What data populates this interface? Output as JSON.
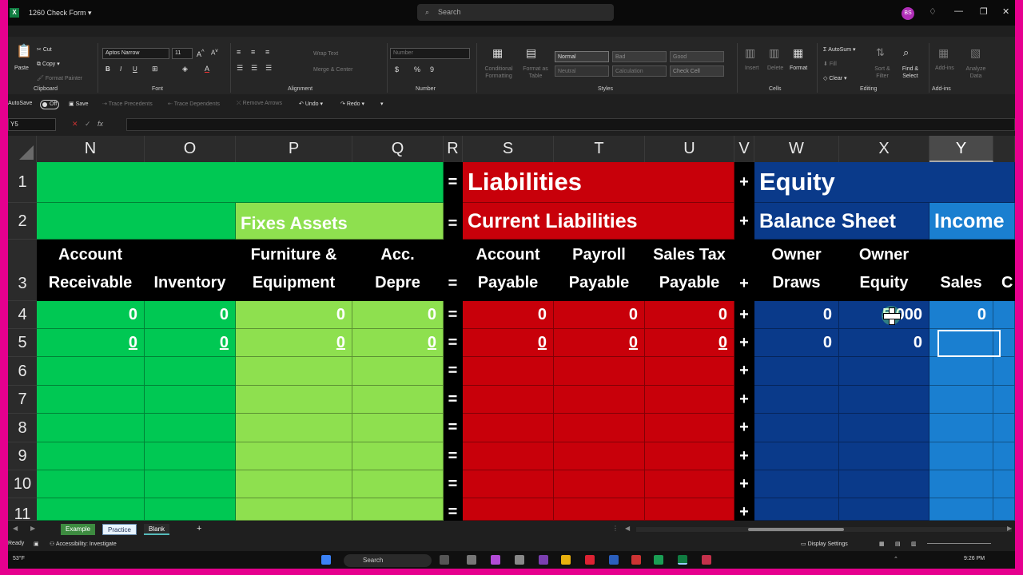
{
  "window": {
    "title": "1260 Check Form",
    "search_placeholder": "Search",
    "user_initials": "BS"
  },
  "ribbon": {
    "clipboard": {
      "paste": "Paste",
      "cut": "Cut",
      "copy": "Copy",
      "format_painter": "Format Painter",
      "label": "Clipboard"
    },
    "font": {
      "name": "Aptos Narrow",
      "size": "11",
      "label": "Font"
    },
    "alignment": {
      "wrap_text": "Wrap Text",
      "merge_center": "Merge & Center",
      "label": "Alignment"
    },
    "number": {
      "format": "Number",
      "label": "Number"
    },
    "styles": {
      "conditional_formatting": "Conditional Formatting",
      "format_as_table": "Format as Table",
      "normal": "Normal",
      "bad": "Bad",
      "good": "Good",
      "neutral": "Neutral",
      "calculation": "Calculation",
      "check_cell": "Check Cell",
      "label": "Styles"
    },
    "cells": {
      "insert": "Insert",
      "delete": "Delete",
      "format": "Format",
      "label": "Cells"
    },
    "editing": {
      "autosum": "AutoSum",
      "fill": "Fill",
      "clear": "Clear",
      "sort_filter": "Sort & Filter",
      "find_select": "Find & Select",
      "label": "Editing"
    },
    "addins": {
      "addins": "Add-ins",
      "analyze_data": "Analyze Data",
      "label": "Add-ins"
    }
  },
  "qat": {
    "autosave": "AutoSave",
    "autosave_state": "Off",
    "save": "Save",
    "trace_precedents": "Trace Precedents",
    "trace_dependents": "Trace Dependents",
    "remove_arrows": "Remove Arrows",
    "undo": "Undo",
    "redo": "Redo"
  },
  "formula_bar": {
    "name_box": "Y5",
    "fx": "fx"
  },
  "grid": {
    "columns": [
      "N",
      "O",
      "P",
      "Q",
      "R",
      "S",
      "T",
      "U",
      "V",
      "W",
      "X",
      "Y"
    ],
    "rows": [
      "1",
      "2",
      "3",
      "4",
      "5",
      "6",
      "7",
      "8",
      "9",
      "10",
      "11"
    ],
    "row1": {
      "eq": "=",
      "liabilities": "Liabilities",
      "plus": "+",
      "equity": "Equity"
    },
    "row2": {
      "fixes_assets": "Fixes Assets",
      "eq": "=",
      "current_liabilities": "Current Liabilities",
      "plus": "+",
      "balance_sheet": "Balance Sheet",
      "income": "Income"
    },
    "row3": {
      "n": [
        "Account",
        "Receivable"
      ],
      "o": "Inventory",
      "p": [
        "Furniture &",
        "Equipment"
      ],
      "q": [
        "Acc.",
        "Depre"
      ],
      "r": "=",
      "s": [
        "Account",
        "Payable"
      ],
      "t": [
        "Payroll",
        "Payable"
      ],
      "u": [
        "Sales Tax",
        "Payable"
      ],
      "v": "+",
      "w": [
        "Owner",
        "Draws"
      ],
      "x": [
        "Owner",
        "Equity"
      ],
      "y": "Sales",
      "z": "C"
    },
    "row4": {
      "n": "0",
      "o": "0",
      "p": "0",
      "q": "0",
      "r": "=",
      "s": "0",
      "t": "0",
      "u": "0",
      "v": "+",
      "w": "0",
      "x": "5,000",
      "y": "0"
    },
    "row5": {
      "n": "0",
      "o": "0",
      "p": "0",
      "q": "0",
      "r": "=",
      "s": "0",
      "t": "0",
      "u": "0",
      "v": "+",
      "w": "0",
      "x": "0"
    },
    "op_eq": "=",
    "op_plus": "+"
  },
  "sheets": {
    "tabs": [
      "Example",
      "Practice",
      "Blank"
    ],
    "active": "Blank",
    "add": "+"
  },
  "status": {
    "ready": "Ready",
    "accessibility": "Accessibility: Investigate",
    "display_settings": "Display Settings",
    "temp": "53°F"
  },
  "taskbar": {
    "search": "Search",
    "time": "9:26 PM"
  },
  "colors": {
    "assets_green": "#00c853",
    "fixed_assets_green": "#8ee04f",
    "liabilities_red": "#c8000a",
    "equity_navy": "#0a3a8a",
    "income_blue": "#1a7fd0",
    "frame_magenta": "#e6008e"
  }
}
